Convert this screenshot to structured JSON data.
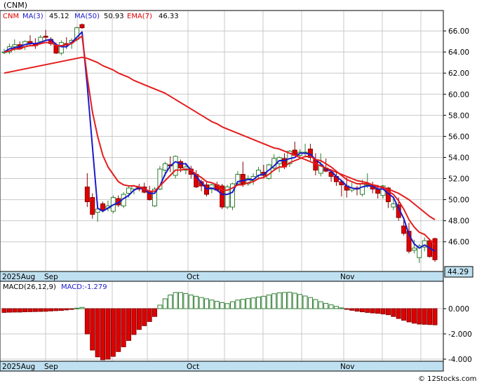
{
  "title": "(CNM)",
  "legend": {
    "symbol": "CNM",
    "ma3_label": "MA(3)",
    "ma3_value": "45.12",
    "ma50_label": "MA(50)",
    "ma50_value": "50.93",
    "ema7_label": "EMA(7)",
    "ema7_value": "46.33"
  },
  "macd_legend": {
    "label": "MACD(26,12,9)",
    "value_label": "MACD:-1.279"
  },
  "last_price_badge": "44.29",
  "watermark": "© 12Stocks.com",
  "x_axis_labels": [
    "2025Aug",
    "Sep",
    "Oct",
    "Nov"
  ],
  "colors": {
    "up": "#2e7d32",
    "down": "#e00000",
    "ma_short": "#1a1acc",
    "ma_long": "#e41c1c",
    "axis_bar": "#bfe0f0",
    "grid": "#c8c8c8"
  },
  "chart_data": [
    {
      "type": "candlestick",
      "title": "(CNM)",
      "y_ticks": [
        "66.00",
        "64.00",
        "62.00",
        "60.00",
        "58.00",
        "56.00",
        "54.00",
        "52.00",
        "50.00",
        "48.00",
        "46.00"
      ],
      "ylim": [
        44.0,
        67.5
      ],
      "grid": true,
      "x_labels": [
        "2025Aug",
        "Sep",
        "Oct",
        "Nov"
      ],
      "candles": [
        [
          64.0,
          64.3,
          63.8,
          64.0
        ],
        [
          64.0,
          64.8,
          63.8,
          64.5
        ],
        [
          64.5,
          65.2,
          64.1,
          64.7
        ],
        [
          64.7,
          65.0,
          64.2,
          64.3
        ],
        [
          64.5,
          65.1,
          64.2,
          65.0
        ],
        [
          65.0,
          65.6,
          64.6,
          64.8
        ],
        [
          64.8,
          65.3,
          64.3,
          64.6
        ],
        [
          65.0,
          65.6,
          64.7,
          65.4
        ],
        [
          65.5,
          66.1,
          65.1,
          65.4
        ],
        [
          65.2,
          65.4,
          64.6,
          64.8
        ],
        [
          64.6,
          64.9,
          63.8,
          63.9
        ],
        [
          63.9,
          65.1,
          63.7,
          64.9
        ],
        [
          64.8,
          65.4,
          64.3,
          64.7
        ],
        [
          64.9,
          65.3,
          64.3,
          65.1
        ],
        [
          65.2,
          66.4,
          65.0,
          66.3
        ],
        [
          66.6,
          66.7,
          66.2,
          66.3
        ],
        [
          51.2,
          52.5,
          49.3,
          49.8
        ],
        [
          50.2,
          50.6,
          48.2,
          48.6
        ],
        [
          48.8,
          49.8,
          47.9,
          49.1
        ],
        [
          49.6,
          49.8,
          48.8,
          49.0
        ],
        [
          49.2,
          49.9,
          48.9,
          49.4
        ],
        [
          48.9,
          50.4,
          48.7,
          50.2
        ],
        [
          50.1,
          50.4,
          49.3,
          49.5
        ],
        [
          49.4,
          50.7,
          49.2,
          50.5
        ],
        [
          50.6,
          51.3,
          50.2,
          51.1
        ],
        [
          51.0,
          51.4,
          50.5,
          51.3
        ],
        [
          51.2,
          51.5,
          50.8,
          51.0
        ],
        [
          51.2,
          51.6,
          50.6,
          50.7
        ],
        [
          50.8,
          51.3,
          49.9,
          50.0
        ],
        [
          49.4,
          51.2,
          49.3,
          51.0
        ],
        [
          51.0,
          53.2,
          50.9,
          52.9
        ],
        [
          52.8,
          53.6,
          52.2,
          53.4
        ],
        [
          53.3,
          54.1,
          52.6,
          53.2
        ],
        [
          52.3,
          54.2,
          52.0,
          54.1
        ],
        [
          53.6,
          53.8,
          52.6,
          53.0
        ],
        [
          52.8,
          53.5,
          52.4,
          53.1
        ],
        [
          52.9,
          53.2,
          52.0,
          52.4
        ],
        [
          52.4,
          52.8,
          51.1,
          51.2
        ],
        [
          51.7,
          51.9,
          50.8,
          51.3
        ],
        [
          51.4,
          51.8,
          50.3,
          50.5
        ],
        [
          51.0,
          51.6,
          50.6,
          51.4
        ],
        [
          51.4,
          51.7,
          50.8,
          50.9
        ],
        [
          51.3,
          51.5,
          49.1,
          49.3
        ],
        [
          49.3,
          51.4,
          49.1,
          51.2
        ],
        [
          49.3,
          51.6,
          49.0,
          51.5
        ],
        [
          51.5,
          52.7,
          51.3,
          52.4
        ],
        [
          52.4,
          53.6,
          51.2,
          51.5
        ],
        [
          51.5,
          52.3,
          51.3,
          52.0
        ],
        [
          51.8,
          52.5,
          51.4,
          52.2
        ],
        [
          52.3,
          53.1,
          51.9,
          52.8
        ],
        [
          52.6,
          53.3,
          52.0,
          52.3
        ],
        [
          52.0,
          53.4,
          51.9,
          53.3
        ],
        [
          53.0,
          54.3,
          52.7,
          53.9
        ],
        [
          53.4,
          54.1,
          52.6,
          54.0
        ],
        [
          53.9,
          54.4,
          52.9,
          53.1
        ],
        [
          53.4,
          54.7,
          53.1,
          54.6
        ],
        [
          54.7,
          55.5,
          54.2,
          54.2
        ],
        [
          54.2,
          54.8,
          53.9,
          54.5
        ],
        [
          54.5,
          55.3,
          54.1,
          54.5
        ],
        [
          54.8,
          55.3,
          53.7,
          54.0
        ],
        [
          53.8,
          54.4,
          52.3,
          52.8
        ],
        [
          52.5,
          54.4,
          52.2,
          53.3
        ],
        [
          53.0,
          53.9,
          52.6,
          52.7
        ],
        [
          52.6,
          52.9,
          51.7,
          52.2
        ],
        [
          52.2,
          52.7,
          51.3,
          51.7
        ],
        [
          51.7,
          51.9,
          50.3,
          51.4
        ],
        [
          51.3,
          52.1,
          50.2,
          50.9
        ],
        [
          50.9,
          51.6,
          50.7,
          51.1
        ],
        [
          51.1,
          51.3,
          50.4,
          51.0
        ],
        [
          50.5,
          51.9,
          50.3,
          51.5
        ],
        [
          51.4,
          52.5,
          51.1,
          51.4
        ],
        [
          51.4,
          51.7,
          50.6,
          51.0
        ],
        [
          51.0,
          51.4,
          50.1,
          50.6
        ],
        [
          50.4,
          51.4,
          50.1,
          51.3
        ],
        [
          51.1,
          51.2,
          49.2,
          49.8
        ],
        [
          49.3,
          50.3,
          49.0,
          49.6
        ],
        [
          49.5,
          50.2,
          48.0,
          48.3
        ],
        [
          47.5,
          48.3,
          46.6,
          46.8
        ],
        [
          47.0,
          47.8,
          44.9,
          45.1
        ],
        [
          45.2,
          46.2,
          44.9,
          45.4
        ],
        [
          44.5,
          45.8,
          44.0,
          45.6
        ],
        [
          45.5,
          46.4,
          45.1,
          46.1
        ],
        [
          46.1,
          46.3,
          44.5,
          44.6
        ],
        [
          46.3,
          46.4,
          44.1,
          44.3
        ]
      ],
      "series": [
        {
          "name": "MA(3)",
          "values": [
            64.0,
            64.3,
            64.4,
            64.5,
            64.7,
            64.8,
            64.8,
            64.9,
            65.1,
            65.2,
            64.7,
            64.5,
            64.5,
            64.9,
            65.4,
            65.9,
            60.8,
            55.0,
            49.2,
            48.9,
            49.2,
            49.5,
            49.7,
            50.1,
            50.4,
            50.9,
            51.1,
            51.0,
            50.6,
            50.6,
            51.3,
            52.4,
            53.2,
            53.6,
            53.4,
            53.4,
            52.8,
            52.2,
            51.6,
            51.0,
            51.1,
            50.9,
            50.5,
            50.5,
            50.7,
            51.7,
            51.8,
            51.9,
            51.9,
            52.3,
            52.4,
            52.8,
            53.2,
            53.7,
            53.7,
            53.9,
            54.0,
            54.4,
            54.4,
            54.3,
            53.8,
            53.4,
            52.9,
            52.7,
            52.2,
            51.8,
            51.3,
            51.1,
            51.0,
            51.2,
            51.3,
            51.3,
            51.0,
            51.0,
            50.6,
            50.2,
            49.2,
            48.2,
            46.7,
            45.8,
            45.4,
            45.7,
            45.4,
            45.1
          ]
        },
        {
          "name": "EMA(7)",
          "values": [
            64.0,
            64.1,
            64.3,
            64.3,
            64.5,
            64.6,
            64.6,
            64.8,
            64.9,
            64.9,
            64.6,
            64.6,
            64.7,
            64.8,
            65.2,
            65.5,
            61.6,
            58.3,
            56.0,
            54.2,
            53.1,
            52.4,
            51.7,
            51.4,
            51.3,
            51.3,
            51.2,
            51.0,
            50.8,
            50.8,
            51.3,
            51.8,
            52.3,
            52.8,
            52.8,
            52.9,
            52.8,
            52.4,
            52.1,
            51.7,
            51.6,
            51.4,
            50.9,
            50.9,
            51.1,
            51.4,
            51.4,
            51.6,
            51.7,
            52.0,
            52.1,
            52.4,
            52.8,
            53.1,
            53.1,
            53.5,
            53.7,
            53.9,
            54.1,
            54.1,
            53.8,
            53.7,
            53.4,
            53.1,
            52.7,
            52.3,
            51.9,
            51.7,
            51.5,
            51.5,
            51.5,
            51.4,
            51.2,
            51.2,
            50.8,
            50.5,
            49.9,
            49.1,
            48.1,
            47.4,
            46.9,
            46.7,
            46.2,
            45.7
          ]
        },
        {
          "name": "MA(50)",
          "values": [
            62.0,
            62.1,
            62.2,
            62.3,
            62.4,
            62.5,
            62.6,
            62.7,
            62.8,
            62.9,
            63.0,
            63.1,
            63.2,
            63.3,
            63.4,
            63.5,
            63.4,
            63.2,
            63.0,
            62.7,
            62.5,
            62.3,
            62.0,
            61.8,
            61.6,
            61.3,
            61.1,
            60.9,
            60.7,
            60.5,
            60.3,
            60.1,
            59.8,
            59.5,
            59.2,
            58.9,
            58.6,
            58.3,
            58.0,
            57.7,
            57.4,
            57.2,
            56.9,
            56.7,
            56.5,
            56.3,
            56.1,
            55.9,
            55.7,
            55.5,
            55.3,
            55.1,
            54.9,
            54.8,
            54.6,
            54.4,
            54.2,
            54.0,
            53.8,
            53.6,
            53.4,
            53.2,
            53.0,
            52.8,
            52.6,
            52.4,
            52.2,
            52.0,
            51.8,
            51.7,
            51.6,
            51.4,
            51.3,
            51.1,
            51.0,
            50.8,
            50.6,
            50.3,
            50.0,
            49.6,
            49.2,
            48.8,
            48.4,
            48.1
          ]
        }
      ]
    },
    {
      "type": "bar",
      "title": "MACD(26,12,9)",
      "y_ticks": [
        "0.000",
        "-2.000",
        "-4.000"
      ],
      "ylim": [
        -4.1,
        0.65
      ],
      "values": [
        -0.3,
        -0.28,
        -0.27,
        -0.27,
        -0.25,
        -0.24,
        -0.23,
        -0.22,
        -0.21,
        -0.18,
        -0.16,
        -0.14,
        -0.1,
        -0.06,
        0.04,
        0.1,
        -2.0,
        -3.28,
        -3.82,
        -4.05,
        -4.0,
        -3.78,
        -3.4,
        -3.02,
        -2.52,
        -2.05,
        -1.65,
        -1.35,
        -1.02,
        -0.62,
        0.28,
        0.78,
        1.08,
        1.28,
        1.28,
        1.2,
        1.08,
        0.98,
        0.88,
        0.78,
        0.68,
        0.58,
        0.48,
        0.4,
        0.55,
        0.68,
        0.74,
        0.8,
        0.85,
        0.92,
        0.98,
        1.08,
        1.18,
        1.25,
        1.28,
        1.3,
        1.22,
        1.12,
        1.0,
        0.88,
        0.72,
        0.55,
        0.42,
        0.3,
        0.18,
        0.06,
        -0.05,
        -0.13,
        -0.2,
        -0.25,
        -0.3,
        -0.34,
        -0.37,
        -0.42,
        -0.48,
        -0.62,
        -0.78,
        -0.92,
        -1.05,
        -1.15,
        -1.22,
        -1.24,
        -1.26,
        -1.28
      ]
    }
  ]
}
